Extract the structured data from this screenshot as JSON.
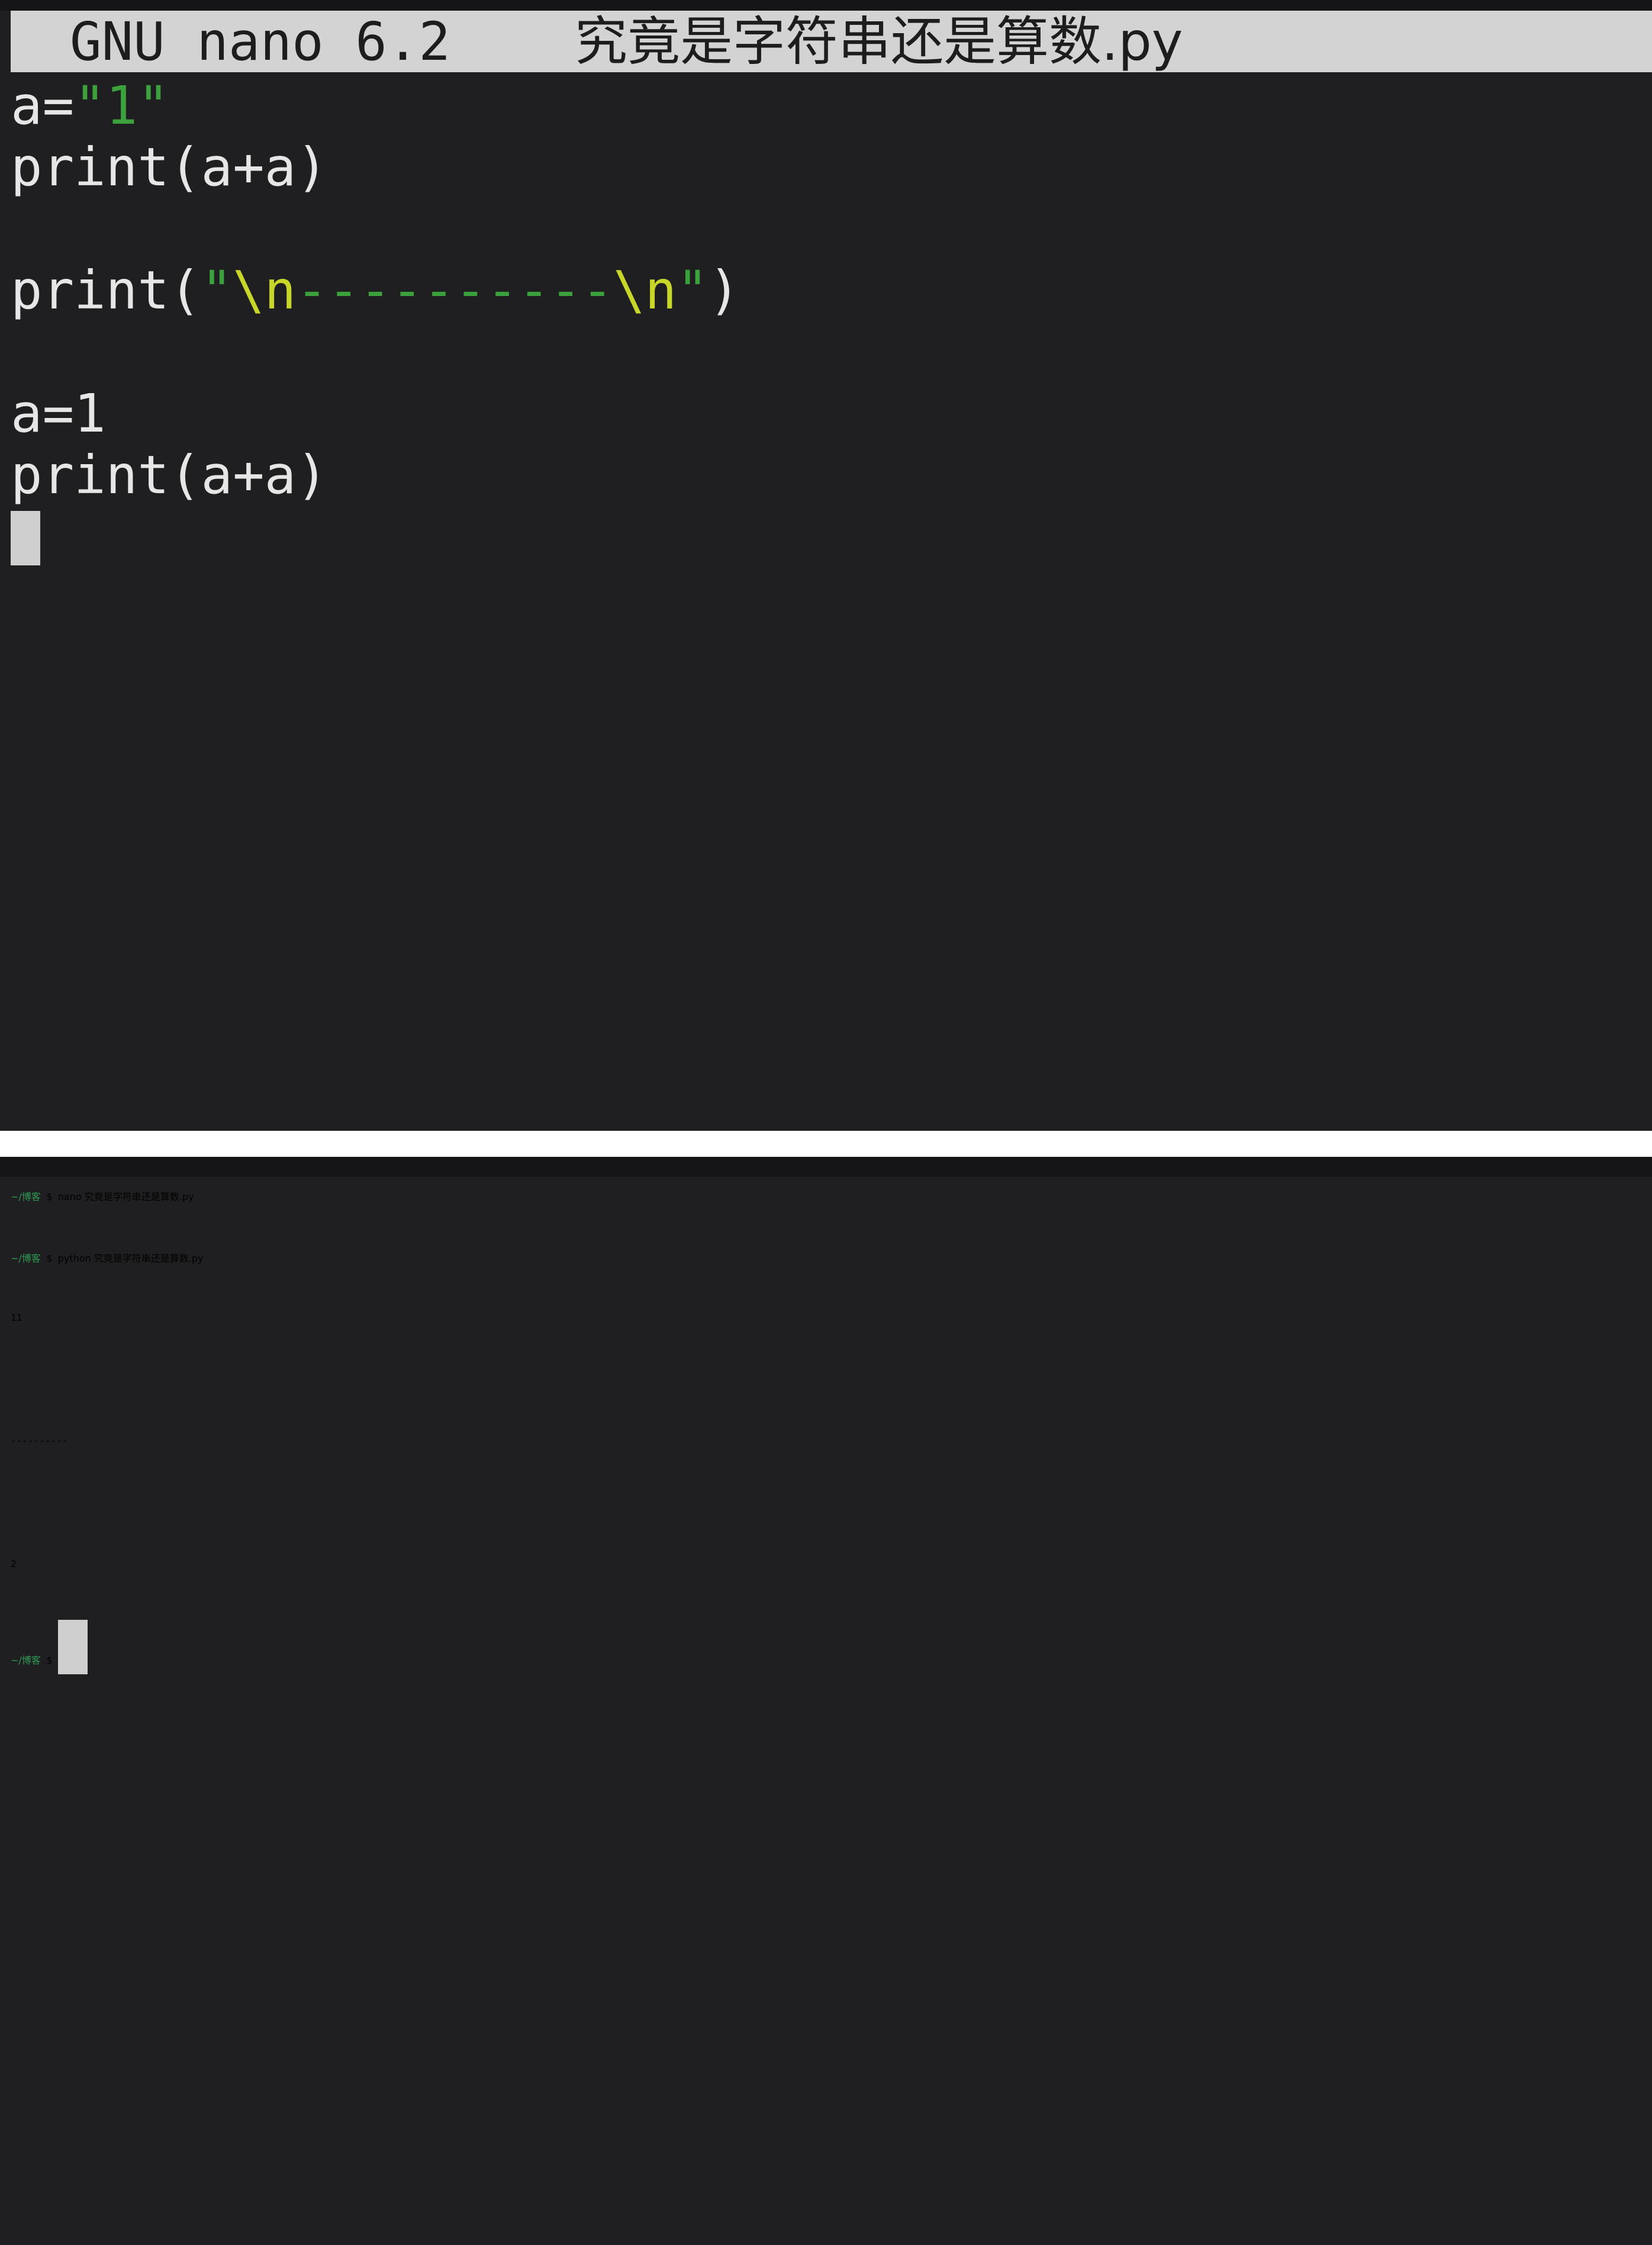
{
  "nano": {
    "app_name": "GNU nano 6.2",
    "filename": "究竟是字符串还是算数.py",
    "code": {
      "line1_a": "a=",
      "line1_str": "\"1\"",
      "line2": "print(a+a)",
      "line4_open": "print(",
      "line4_quote1": "\"",
      "line4_esc1": "\\n",
      "line4_dashes": "----------",
      "line4_esc2": "\\n",
      "line4_quote2": "\"",
      "line4_close": ")",
      "line6": "a=1",
      "line7": "print(a+a)"
    }
  },
  "terminal": {
    "prompt_path": "~/博客",
    "prompt_symbol": "$",
    "cmd1": "nano 究竟是字符串还是算数.py",
    "cmd2": "python 究竟是字符串还是算数.py",
    "output": {
      "line1": "11",
      "line2": "",
      "line3": "----------",
      "line4": "",
      "line5": "2"
    }
  }
}
